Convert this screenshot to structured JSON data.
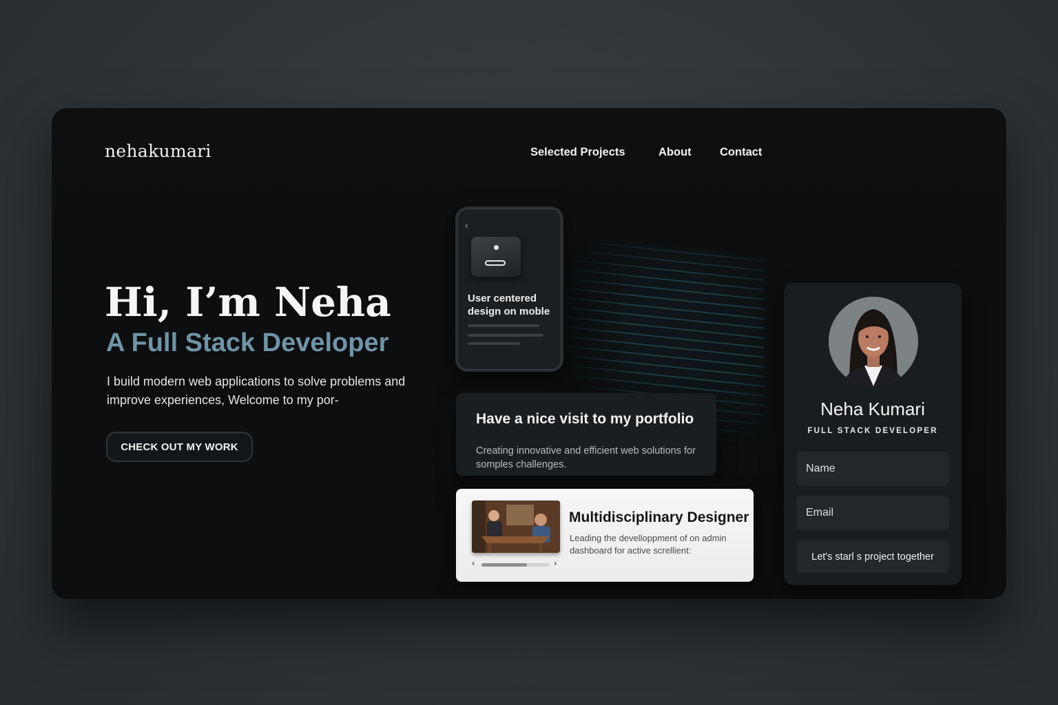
{
  "brand": {
    "logo": "nehakumari"
  },
  "nav": {
    "items": [
      "Selected Projects",
      "About",
      "Contact"
    ]
  },
  "hero": {
    "title": "Hi, I’m Neha",
    "subtitle": "A Full Stack Developer",
    "description": "I build modern web applications to solve problems and improve experiences, Welcome to my por-",
    "cta": "CHECK OUT MY WORK"
  },
  "phone_card": {
    "title": "User centered design on moble"
  },
  "visit_card": {
    "title": "Have a nice visit to my portfolio",
    "text": "Creating innovative and efficient web solutions for somples challenges."
  },
  "designer_card": {
    "title": "Multidisciplinary Designer",
    "text": "Leading the develloppment of on admin dashboard for active screllient:",
    "carousel_progress": 0.67
  },
  "profile": {
    "name": "Neha Kumari",
    "role": "FULL STACK DEVELOPER",
    "name_placeholder": "Name",
    "email_placeholder": "Email",
    "submit": "Let's starl s project together"
  },
  "colors": {
    "accent": "#6f94a8",
    "frame": "#0d0f11",
    "card": "#1b1e21"
  },
  "icons": {
    "back": "chevron-left-icon",
    "prev": "chevron-left-icon",
    "next": "chevron-right-icon"
  }
}
